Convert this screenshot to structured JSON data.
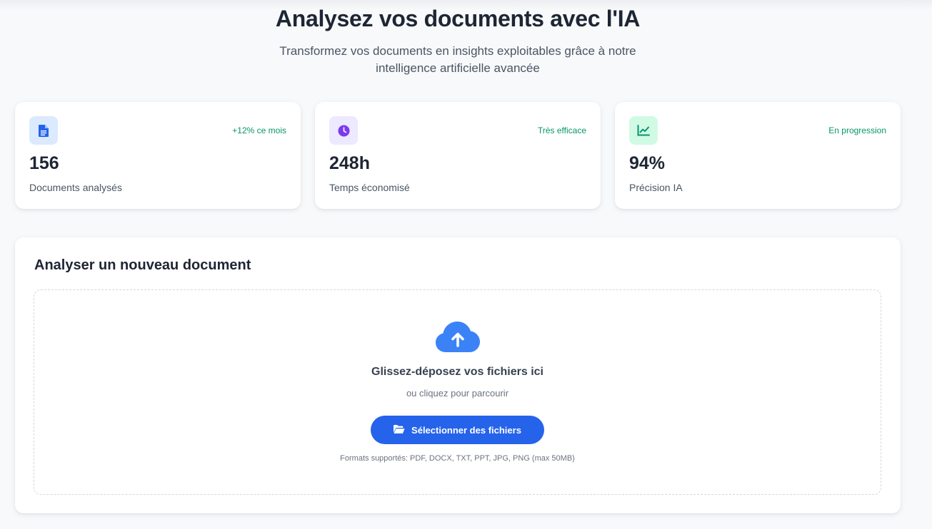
{
  "hero": {
    "title": "Analysez vos documents avec l'IA",
    "subtitle": "Transformez vos documents en insights exploitables grâce à notre intelligence artificielle avancée"
  },
  "stats": [
    {
      "icon": "document-icon",
      "trend": "+12% ce mois",
      "value": "156",
      "label": "Documents analysés",
      "icon_bg": "#dbeafe",
      "icon_color": "#2563eb"
    },
    {
      "icon": "clock-icon",
      "trend": "Très efficace",
      "value": "248h",
      "label": "Temps économisé",
      "icon_bg": "#ede9fe",
      "icon_color": "#7c3aed"
    },
    {
      "icon": "chart-line-icon",
      "trend": "En progression",
      "value": "94%",
      "label": "Précision IA",
      "icon_bg": "#d1fae5",
      "icon_color": "#059669"
    }
  ],
  "upload": {
    "title": "Analyser un nouveau document",
    "icon": "cloud-upload-icon",
    "dropzone_title": "Glissez-déposez vos fichiers ici",
    "dropzone_subtitle": "ou cliquez pour parcourir",
    "button_icon": "folder-open-icon",
    "button_label": "Sélectionner des fichiers",
    "formats": "Formats supportés: PDF, DOCX, TXT, PPT, JPG, PNG (max 50MB)"
  },
  "colors": {
    "accent": "#2563eb",
    "trend_green": "#059669",
    "cloud_blue": "#3b82f6"
  }
}
